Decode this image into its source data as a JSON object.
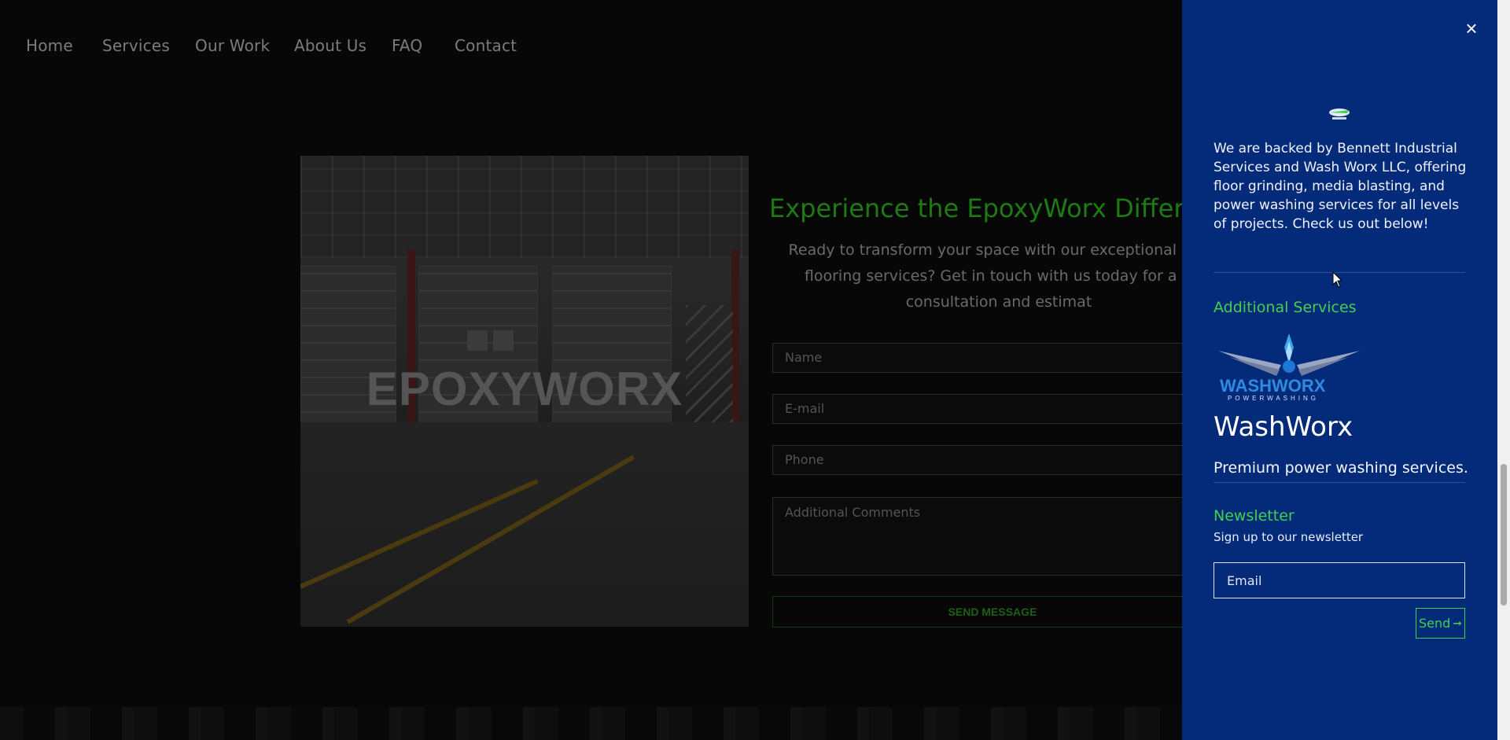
{
  "nav": {
    "items": [
      {
        "label": "Home"
      },
      {
        "label": "Services"
      },
      {
        "label": "Our Work"
      },
      {
        "label": "About Us"
      },
      {
        "label": "FAQ"
      },
      {
        "label": "Contact"
      }
    ]
  },
  "hero": {
    "logo_text": "EPOXYWORX"
  },
  "contact": {
    "title": "Experience the EpoxyWorx Differenc",
    "subtitle_lines": [
      "Ready to transform your space with our exceptional epo",
      "flooring services? Get in touch with us today for a fr",
      "consultation and estimat"
    ],
    "name_placeholder": "Name",
    "email_placeholder": "E-mail",
    "phone_placeholder": "Phone",
    "comments_placeholder": "Additional Comments",
    "submit_label": "SEND MESSAGE"
  },
  "panel": {
    "about_text": "We are backed by Bennett Industrial Services and Wash Worx LLC, offering floor grinding, media blasting, and power washing services for all levels of projects. Check us out below!",
    "additional_heading": "Additional Services",
    "washworx_logo_main": "WASHWORX",
    "washworx_logo_sub": "POWERWASHING",
    "washworx_title": "WashWorx",
    "washworx_desc": "Premium power washing services.",
    "newsletter_heading": "Newsletter",
    "newsletter_sub": "Sign up to our newsletter",
    "email_placeholder": "Email",
    "send_label": "Send",
    "close_symbol": "×",
    "send_arrow": "➞"
  },
  "colors": {
    "panel_bg": "#042a7a",
    "accent_green": "#3fd14f",
    "dark_green": "#1e7a14",
    "page_bg": "#070707"
  },
  "icons": [
    "close-icon",
    "epoxyworx-logo-icon",
    "washworx-logo-icon",
    "arrow-right-icon",
    "mouse-cursor-icon"
  ]
}
